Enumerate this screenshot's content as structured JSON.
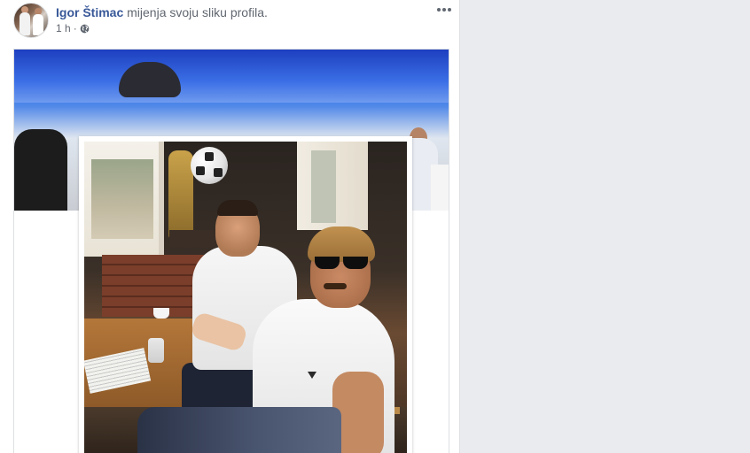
{
  "post": {
    "author_name": "Igor Štimac",
    "action_text": "mijenja svoju sliku profila.",
    "timestamp": "1 h",
    "separator": "·",
    "audience_icon": "globe-icon",
    "more_icon": "more-options-icon"
  },
  "colors": {
    "author_link": "#385898",
    "secondary_text": "#616770",
    "page_background": "#e9ebee",
    "card_background": "#ffffff"
  }
}
